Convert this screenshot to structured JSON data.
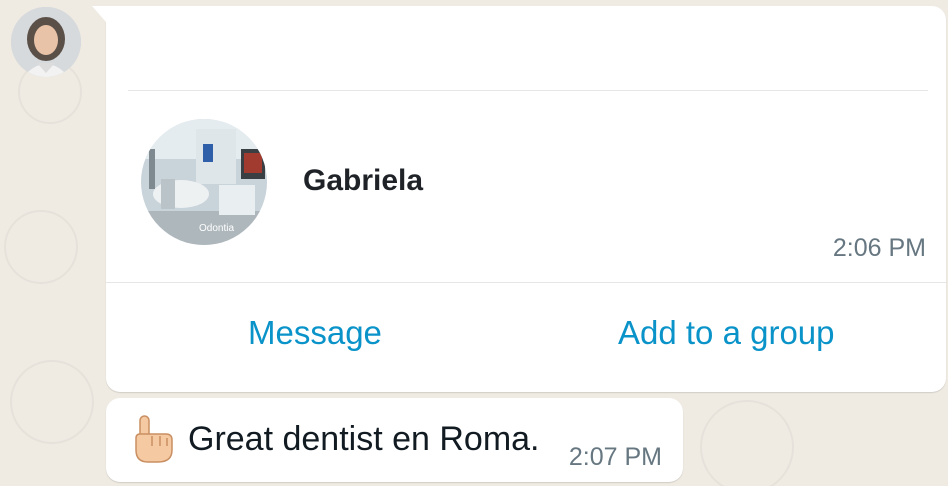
{
  "contact_card": {
    "name": "Gabriela",
    "photo_watermark": "Odontia",
    "time": "2:06 PM",
    "actions": {
      "message": "Message",
      "add_to_group": "Add to a group"
    }
  },
  "message": {
    "emoji_icon": "pointing-up-hand-icon",
    "text": "Great dentist en Roma.",
    "time": "2:07 PM"
  },
  "colors": {
    "chat_background": "#efeae2",
    "bubble": "#ffffff",
    "action_link": "#0a93c9",
    "timestamp": "#667781"
  }
}
